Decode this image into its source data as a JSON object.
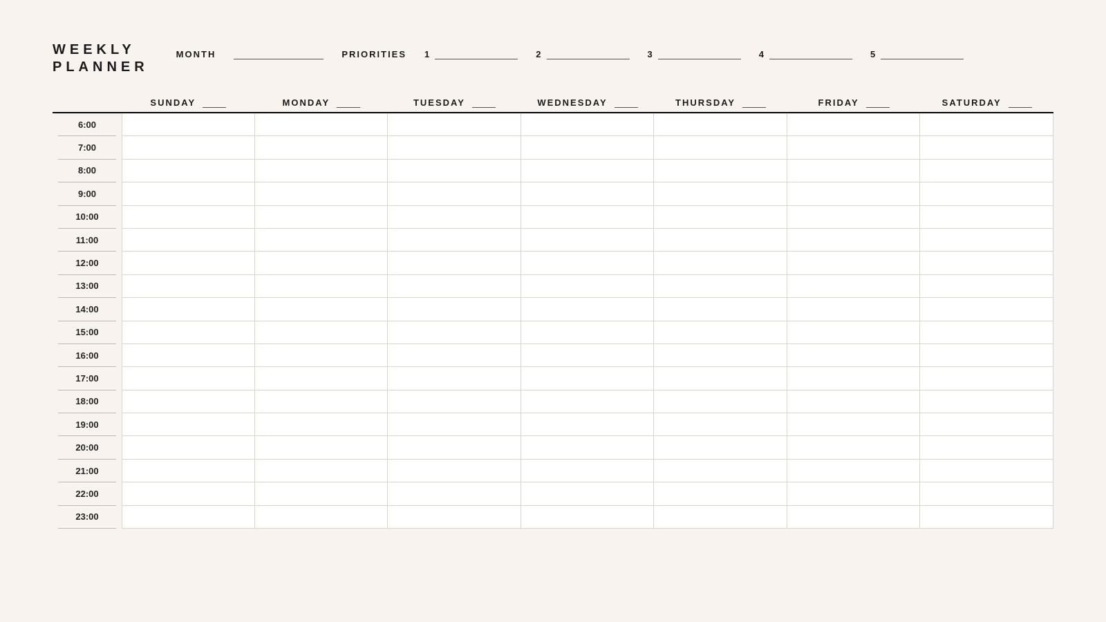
{
  "title": "WEEKLY\nPLANNER",
  "labels": {
    "month": "MONTH",
    "priorities": "PRIORITIES"
  },
  "priorities": [
    {
      "num": "1"
    },
    {
      "num": "2"
    },
    {
      "num": "3"
    },
    {
      "num": "4"
    },
    {
      "num": "5"
    }
  ],
  "days": [
    "SUNDAY",
    "MONDAY",
    "TUESDAY",
    "WEDNESDAY",
    "THURSDAY",
    "FRIDAY",
    "SATURDAY"
  ],
  "hours": [
    "6:00",
    "7:00",
    "8:00",
    "9:00",
    "10:00",
    "11:00",
    "12:00",
    "13:00",
    "14:00",
    "15:00",
    "16:00",
    "17:00",
    "18:00",
    "19:00",
    "20:00",
    "21:00",
    "22:00",
    "23:00"
  ]
}
